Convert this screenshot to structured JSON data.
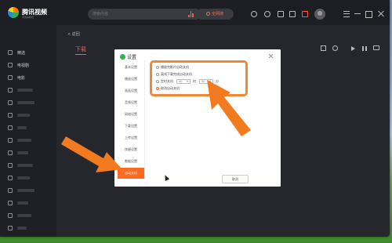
{
  "app": {
    "name": "腾讯视频",
    "tagline": "不负好时光"
  },
  "search": {
    "placeholder": "搜索内容",
    "button_label": "全网搜"
  },
  "sidebar": {
    "items": [
      {
        "label": "精选",
        "icon": "home-icon"
      },
      {
        "label": "电视剧",
        "icon": "tv-icon"
      },
      {
        "label": "电影",
        "icon": "film-icon"
      },
      {
        "label": "",
        "icon": "category-icon"
      },
      {
        "label": "",
        "icon": "category-icon"
      },
      {
        "label": "",
        "icon": "category-icon"
      },
      {
        "label": "",
        "icon": "category-icon"
      },
      {
        "label": "",
        "icon": "category-icon"
      },
      {
        "label": "",
        "icon": "category-icon"
      },
      {
        "label": "",
        "icon": "category-icon"
      },
      {
        "label": "",
        "icon": "category-icon"
      },
      {
        "label": "",
        "icon": "category-icon"
      },
      {
        "label": "",
        "icon": "category-icon"
      },
      {
        "label": "",
        "icon": "category-icon"
      },
      {
        "label": "",
        "icon": "category-icon"
      },
      {
        "label": "",
        "icon": "category-icon"
      },
      {
        "label": "",
        "icon": "category-icon"
      },
      {
        "label": "",
        "icon": "category-icon"
      },
      {
        "label": "",
        "icon": "category-icon"
      }
    ]
  },
  "main": {
    "back_label": "< 返回",
    "page_title": "下载"
  },
  "dialog": {
    "title": "设置",
    "menu": [
      "基本设置",
      "播放设置",
      "画面设置",
      "音频设置",
      "网络设置",
      "下载设置",
      "上传设置",
      "快捷设置",
      "数据设置",
      "自动关机"
    ],
    "active_menu_index": 9,
    "options": [
      {
        "label": "播放完影片自动关机",
        "selected": false
      },
      {
        "label": "离线下载完成自动关机",
        "selected": false
      },
      {
        "label": "定时关机",
        "selected": false,
        "hour": "00",
        "hour_unit": "时",
        "minute": "00",
        "minute_unit": "分"
      },
      {
        "label": "取消自动关机",
        "selected": true
      }
    ],
    "cancel_label": "取消"
  },
  "colors": {
    "accent": "#ff5a3c",
    "highlight_orange": "#f0883a",
    "active_menu": "#ff6a20"
  }
}
